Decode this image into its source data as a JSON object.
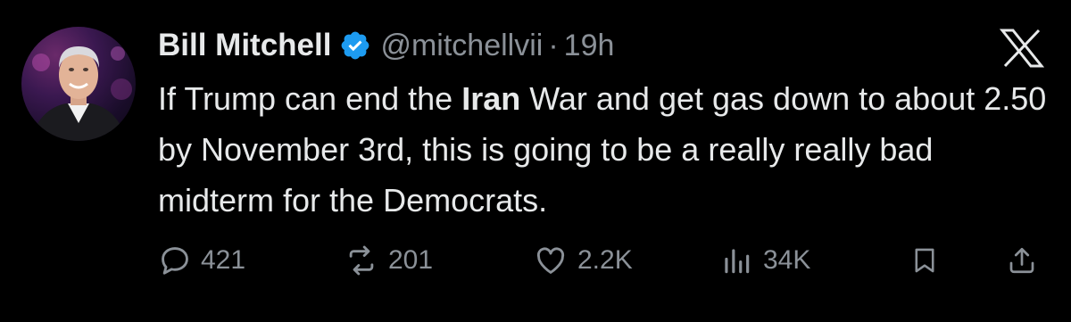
{
  "author": {
    "name": "Bill Mitchell",
    "handle": "@mitchellvii",
    "separator": "·",
    "time": "19h",
    "verified_color": "#1d9bf0"
  },
  "tweet": {
    "text_parts": [
      "If Trump can end the ",
      "Iran",
      " War and get gas down to about 2.50 by November 3rd, this is going to be a really really bad midterm for the Democrats."
    ]
  },
  "actions": {
    "replies": "421",
    "reposts": "201",
    "likes": "2.2K",
    "views": "34K"
  },
  "icons": [
    "x-logo-icon",
    "verified-badge-icon",
    "reply-icon",
    "repost-icon",
    "like-icon",
    "views-icon",
    "bookmark-icon",
    "share-icon"
  ],
  "colors": {
    "background": "#000000",
    "text": "#e7e9ea",
    "muted": "#8b9198",
    "accent": "#1d9bf0"
  }
}
